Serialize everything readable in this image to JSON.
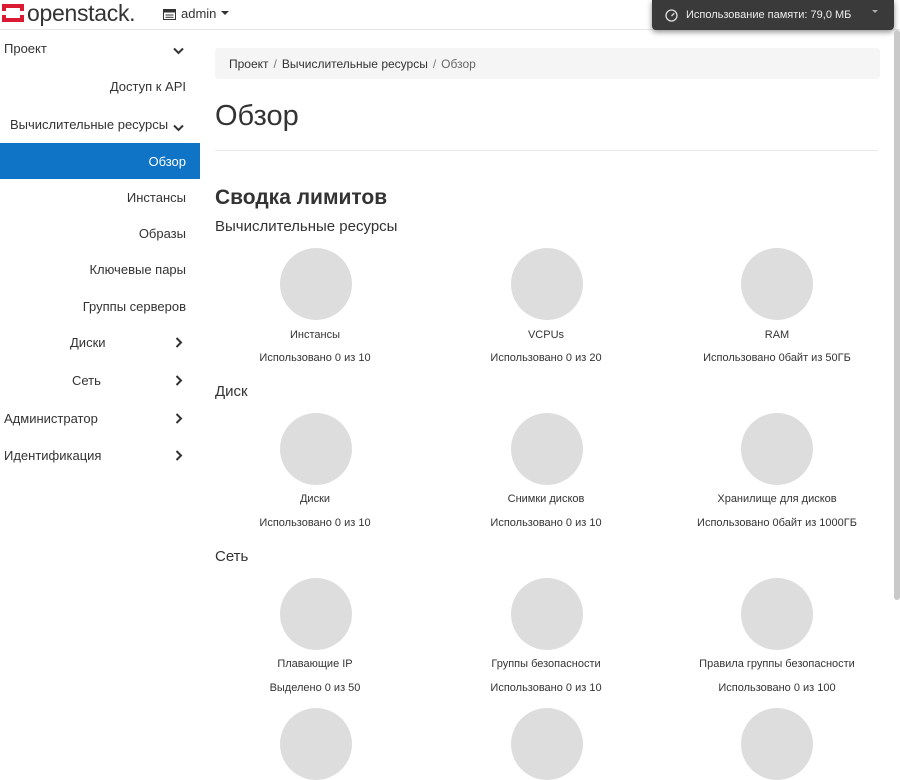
{
  "header": {
    "brand": "openstack.",
    "project": "admin",
    "memory_usage": "Использование памяти: 79,0 МБ"
  },
  "sidebar": {
    "items": [
      {
        "label": "Проект"
      },
      {
        "label": "Доступ к API"
      },
      {
        "label": "Вычислительные ресурсы"
      },
      {
        "label": "Обзор"
      },
      {
        "label": "Инстансы"
      },
      {
        "label": "Образы"
      },
      {
        "label": "Ключевые пары"
      },
      {
        "label": "Группы серверов"
      },
      {
        "label": "Диски"
      },
      {
        "label": "Сеть"
      },
      {
        "label": "Администратор"
      },
      {
        "label": "Идентификация"
      }
    ]
  },
  "breadcrumb": [
    "Проект",
    "Вычислительные ресурсы",
    "Обзор"
  ],
  "page_title": "Обзор",
  "limits": {
    "title": "Сводка лимитов",
    "groups": [
      {
        "title": "Вычислительные ресурсы",
        "charts": [
          {
            "label": "Инстансы",
            "usage": "Использовано 0 из 10"
          },
          {
            "label": "VCPUs",
            "usage": "Использовано 0 из 20"
          },
          {
            "label": "RAM",
            "usage": "Использовано 0байт из 50ГБ"
          }
        ]
      },
      {
        "title": "Диск",
        "charts": [
          {
            "label": "Диски",
            "usage": "Использовано 0 из 10"
          },
          {
            "label": "Снимки дисков",
            "usage": "Использовано 0 из 10"
          },
          {
            "label": "Хранилище для дисков",
            "usage": "Использовано 0байт из 1000ГБ"
          }
        ]
      },
      {
        "title": "Сеть",
        "charts": [
          {
            "label": "Плавающие IP",
            "usage": "Выделено 0 из 50"
          },
          {
            "label": "Группы безопасности",
            "usage": "Использовано 0 из 10"
          },
          {
            "label": "Правила группы безопасности",
            "usage": "Использовано 0 из 100"
          }
        ]
      }
    ]
  },
  "colors": {
    "accent": "#0f73c6",
    "pie_empty": "#dddddd",
    "brand_red": "#da1a32"
  }
}
